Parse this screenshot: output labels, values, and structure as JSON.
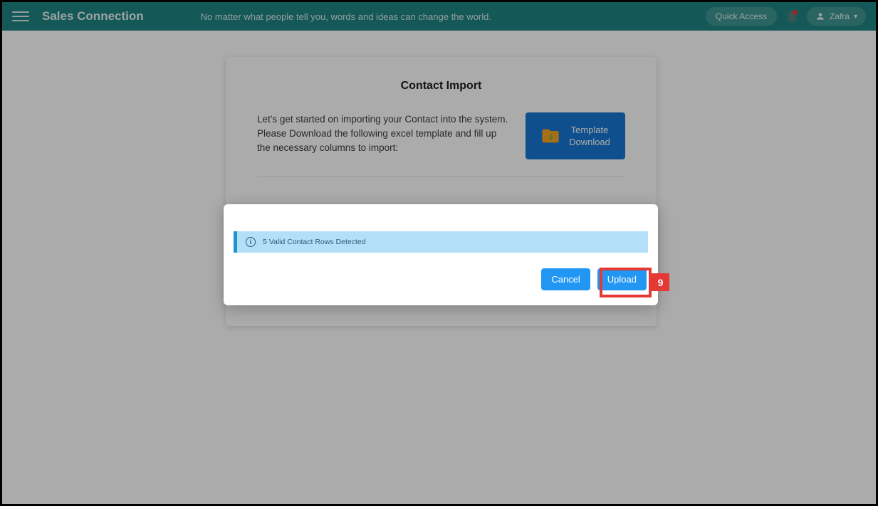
{
  "topbar": {
    "brand": "Sales Connection",
    "tagline": "No matter what people tell you, words and ideas can change the world.",
    "quick_access_label": "Quick Access",
    "user_name": "Zafra"
  },
  "card": {
    "title": "Contact Import",
    "instructions": "Let's get started on importing your Contact into the system. Please Download the following excel template and fill up the necessary columns to import:",
    "download_label_line1": "Template",
    "download_label_line2": "Download"
  },
  "modal": {
    "alert_text": "5 Valid Contact Rows Detected",
    "cancel_label": "Cancel",
    "upload_label": "Upload"
  },
  "callout": {
    "number": "9"
  }
}
